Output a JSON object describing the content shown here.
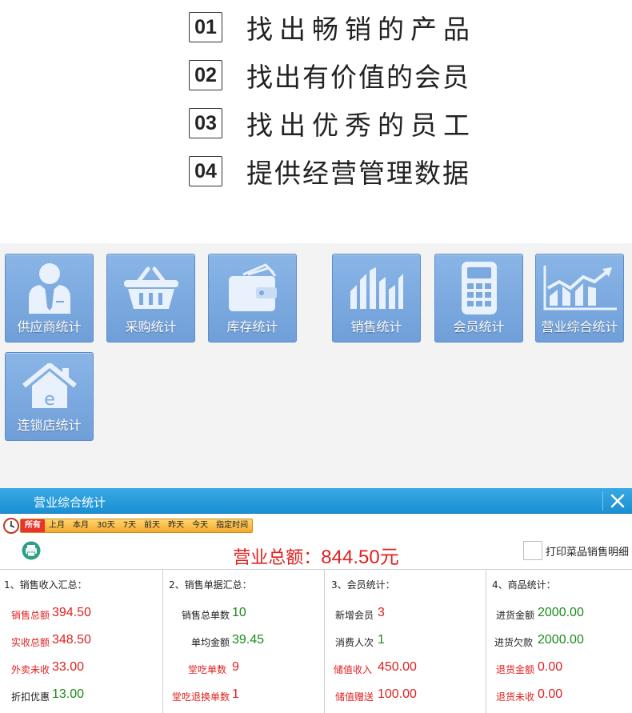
{
  "features": [
    {
      "num": "01",
      "text": "找出畅销的产品"
    },
    {
      "num": "02",
      "text": "找出有价值的会员"
    },
    {
      "num": "03",
      "text": "找出优秀的员工"
    },
    {
      "num": "04",
      "text": "提供经营管理数据"
    }
  ],
  "tiles": [
    {
      "label": "供应商统计",
      "icon": "supplier-person-icon"
    },
    {
      "label": "采购统计",
      "icon": "shopping-basket-icon"
    },
    {
      "label": "库存统计",
      "icon": "wallet-icon"
    },
    {
      "label": "销售统计",
      "icon": "bar-chart-icon"
    },
    {
      "label": "会员统计",
      "icon": "calculator-icon"
    },
    {
      "label": "营业综合统计",
      "icon": "trend-chart-icon"
    },
    {
      "label": "连锁店统计",
      "icon": "store-house-icon"
    }
  ],
  "window": {
    "title": "营业综合统计",
    "filters": [
      "所有",
      "上月",
      "本月",
      "30天",
      "7天",
      "前天",
      "昨天",
      "今天",
      "指定时间"
    ],
    "active_filter": "所有",
    "total_label": "营业总额：",
    "total_value": "844.50元",
    "print_detail_label": "打印菜品销售明细",
    "sections": [
      {
        "title": "1、销售收入汇总：",
        "rows": [
          {
            "label": "销售总额",
            "value": "394.50"
          },
          {
            "label": "实收总额",
            "value": "348.50"
          },
          {
            "label": "外卖未收",
            "value": "33.00"
          },
          {
            "label": "折扣优惠",
            "value": "13.00"
          }
        ]
      },
      {
        "title": "2、销售单据汇总：",
        "rows": [
          {
            "label": "销售总单数",
            "value": "10"
          },
          {
            "label": "单均金额",
            "value": "39.45"
          },
          {
            "label": "堂吃单数",
            "value": "9"
          },
          {
            "label": "堂吃退换单数",
            "value": "1"
          }
        ]
      },
      {
        "title": "3、会员统计：",
        "rows": [
          {
            "label": "新增会员",
            "value": "3"
          },
          {
            "label": "消费人次",
            "value": "1"
          },
          {
            "label": "储值收入",
            "value": "450.00"
          },
          {
            "label": "储值赠送",
            "value": "100.00"
          }
        ]
      },
      {
        "title": "4、商品统计：",
        "rows": [
          {
            "label": "进货金额",
            "value": "2000.00"
          },
          {
            "label": "进货欠款",
            "value": "2000.00"
          },
          {
            "label": "退货金额",
            "value": "0.00"
          },
          {
            "label": "退货未收",
            "value": "0.00"
          }
        ]
      }
    ]
  },
  "colors": {
    "tile_blue": "#7aa9df",
    "title_bar_blue": "#1a8fd3",
    "total_red": "#e02020",
    "value_green": "#1c8a1c",
    "filter_orange": "#f3a92f"
  }
}
